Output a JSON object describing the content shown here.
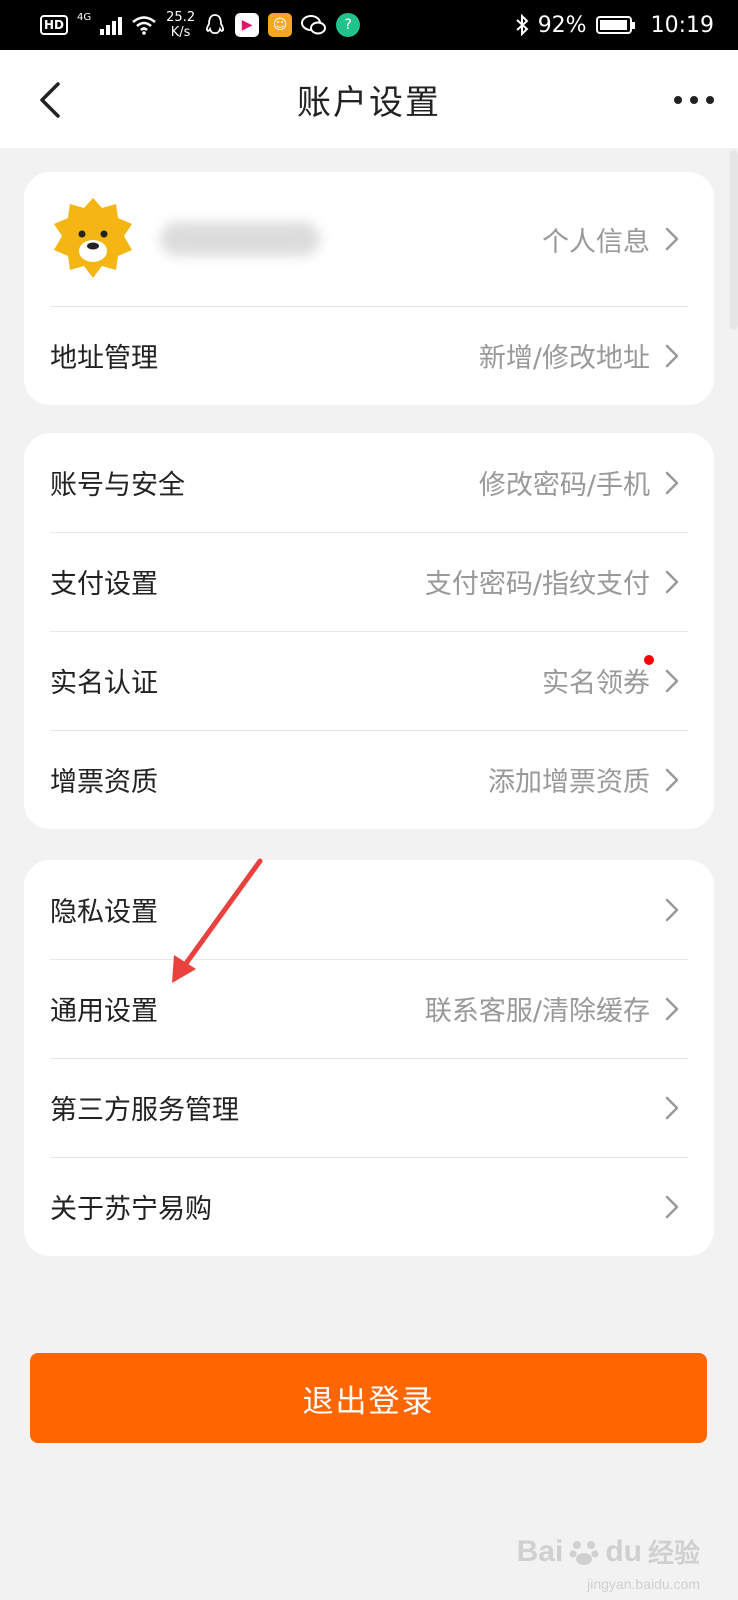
{
  "status_bar": {
    "hd": "HD",
    "network": "4G",
    "speed_value": "25.2",
    "speed_unit": "K/s",
    "battery": "92%",
    "time": "10:19"
  },
  "nav": {
    "title": "账户设置"
  },
  "profile": {
    "link_label": "个人信息"
  },
  "group1": [
    {
      "label": "地址管理",
      "value": "新增/修改地址"
    }
  ],
  "group2": [
    {
      "label": "账号与安全",
      "value": "修改密码/手机"
    },
    {
      "label": "支付设置",
      "value": "支付密码/指纹支付"
    },
    {
      "label": "实名认证",
      "value": "实名领券",
      "has_dot": true
    },
    {
      "label": "增票资质",
      "value": "添加增票资质"
    }
  ],
  "group3": [
    {
      "label": "隐私设置",
      "value": ""
    },
    {
      "label": "通用设置",
      "value": "联系客服/清除缓存"
    },
    {
      "label": "第三方服务管理",
      "value": ""
    },
    {
      "label": "关于苏宁易购",
      "value": ""
    }
  ],
  "logout_label": "退出登录",
  "watermark": {
    "brand": "Bai",
    "brand2": "du",
    "suffix": "经验",
    "url": "jingyan.baidu.com"
  },
  "colors": {
    "accent": "#ff6600",
    "annotation_arrow": "#e8413e",
    "dot": "#ff0000"
  }
}
